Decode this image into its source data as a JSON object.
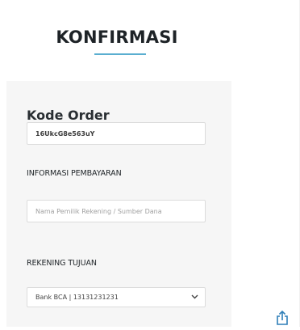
{
  "header": {
    "title": "KONFIRMASI",
    "accent_color": "#5aaed0"
  },
  "form": {
    "order_section_title": "Kode Order",
    "order_code": "16UkcG8e563uY",
    "payment_info_label": "INFORMASI PEMBAYARAN",
    "account_owner_placeholder": "Nama Pemilik Rekening / Sumber Dana",
    "account_owner_value": "",
    "target_account_label": "REKENING TUJUAN",
    "target_account_selected": "Bank BCA | 13131231231"
  },
  "icons": {
    "share": "share-icon",
    "dropdown": "chevron-down-icon"
  }
}
